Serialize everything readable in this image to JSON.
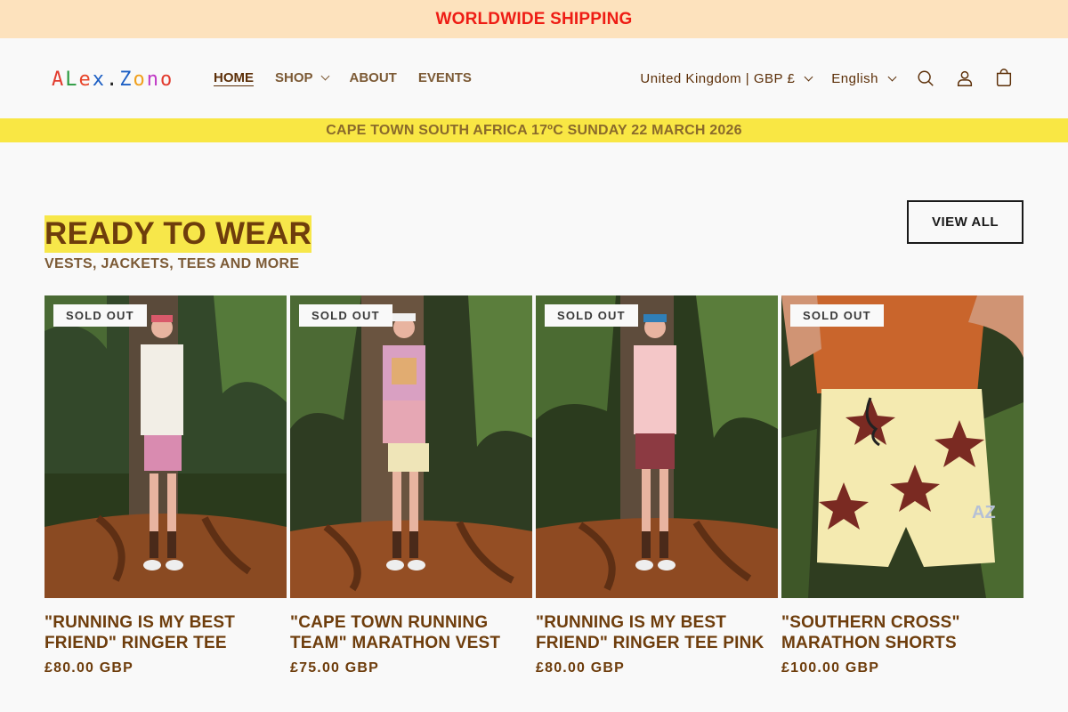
{
  "announcement": "WORLDWIDE SHIPPING",
  "logo": {
    "text": "ALEX.ZONO"
  },
  "nav": [
    {
      "label": "HOME",
      "active": true
    },
    {
      "label": "SHOP",
      "dropdown": true
    },
    {
      "label": "ABOUT"
    },
    {
      "label": "EVENTS"
    }
  ],
  "country_selector": "United Kingdom | GBP £",
  "language_selector": "English",
  "header_icons": [
    "search-icon",
    "account-icon",
    "cart-icon"
  ],
  "event_banner": "CAPE TOWN SOUTH AFRICA 17ºC SUNDAY 22 MARCH 2026",
  "section": {
    "title": "READY TO WEAR",
    "subtitle": "VESTS, JACKETS, TEES AND MORE",
    "view_all": "VIEW ALL"
  },
  "products": [
    {
      "badge": "SOLD OUT",
      "title": "\"RUNNING IS MY BEST FRIEND\" RINGER TEE",
      "price": "£80.00 GBP"
    },
    {
      "badge": "SOLD OUT",
      "title": "\"CAPE TOWN RUNNING TEAM\" MARATHON VEST",
      "price": "£75.00 GBP"
    },
    {
      "badge": "SOLD OUT",
      "title": "\"RUNNING IS MY BEST FRIEND\" RINGER TEE PINK",
      "price": "£80.00 GBP"
    },
    {
      "badge": "SOLD OUT",
      "title": "\"SOUTHERN CROSS\" MARATHON SHORTS",
      "price": "£100.00 GBP"
    }
  ],
  "colors": {
    "announcement_bg": "#fde2bd",
    "announcement_text": "#ee1c14",
    "event_bar_bg": "#f9e744",
    "title_highlight": "#f7e74a",
    "brand_brown": "#6e3d0c"
  }
}
